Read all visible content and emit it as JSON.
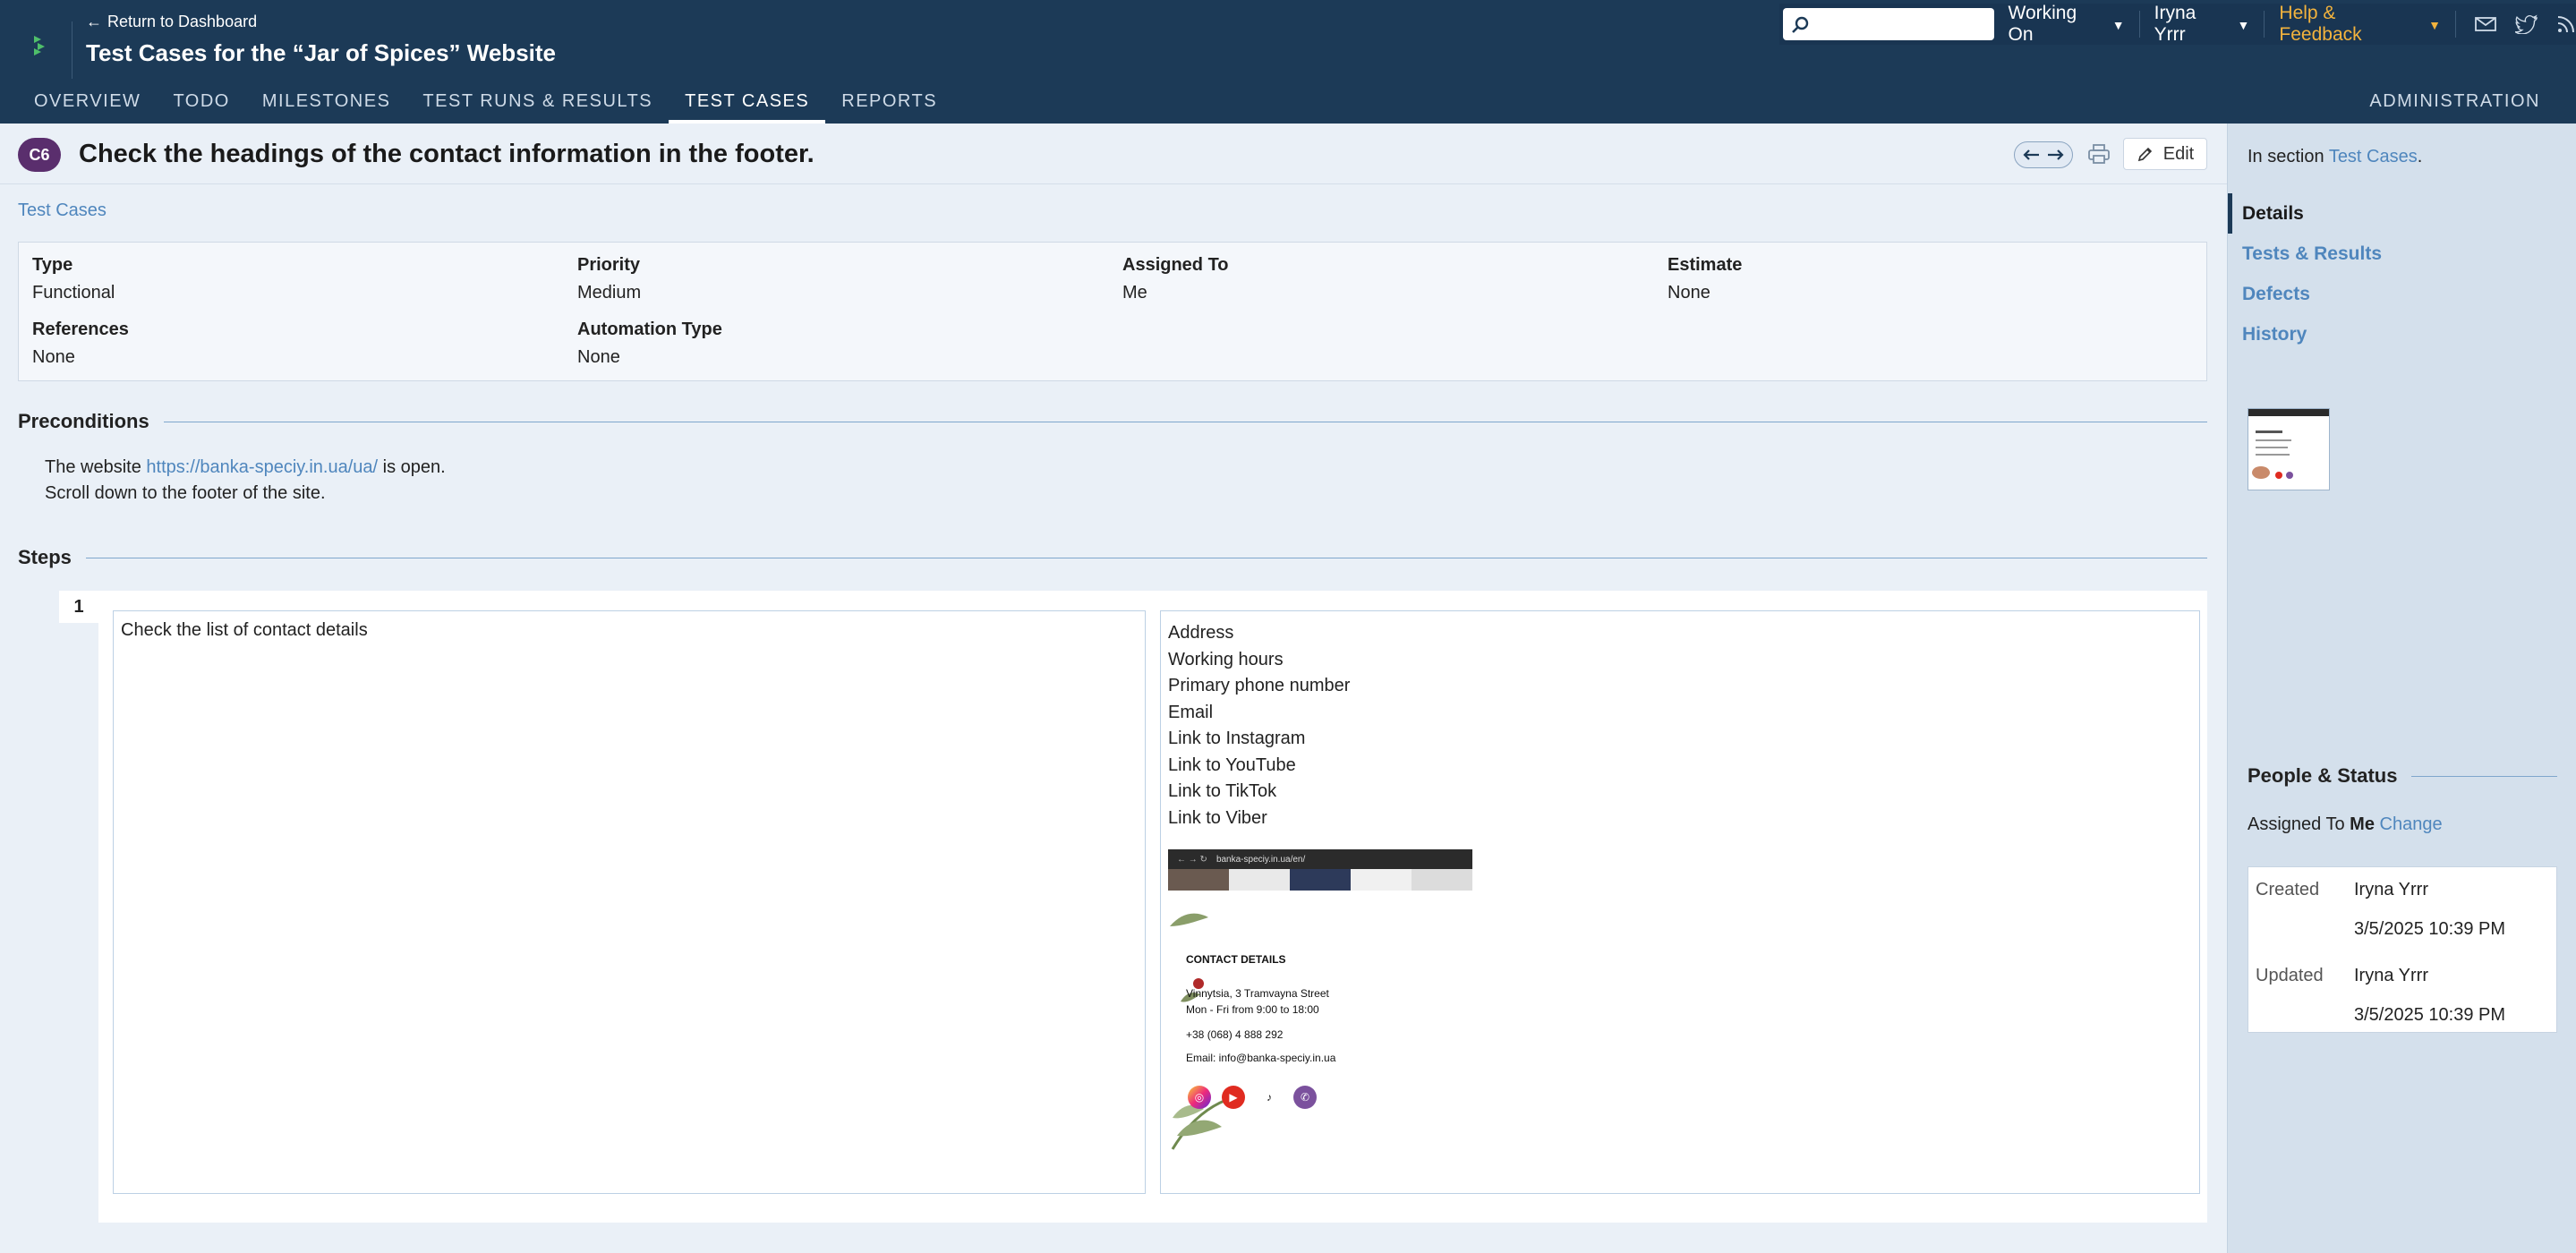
{
  "header": {
    "return_label": "Return to Dashboard",
    "project_title": "Test Cases for the “Jar of Spices” Website",
    "search_placeholder": "",
    "working_on": "Working On",
    "user": "Iryna Yrrr",
    "help": "Help & Feedback",
    "admin": "ADMINISTRATION"
  },
  "nav": {
    "tabs": [
      "OVERVIEW",
      "TODO",
      "MILESTONES",
      "TEST RUNS & RESULTS",
      "TEST CASES",
      "REPORTS"
    ],
    "active": "TEST CASES"
  },
  "case": {
    "id": "C6",
    "title": "Check the headings of the contact information in the footer.",
    "edit_label": "Edit",
    "breadcrumb": "Test Cases"
  },
  "fields": {
    "type_label": "Type",
    "type_value": "Functional",
    "priority_label": "Priority",
    "priority_value": "Medium",
    "assigned_label": "Assigned To",
    "assigned_value": "Me",
    "estimate_label": "Estimate",
    "estimate_value": "None",
    "references_label": "References",
    "references_value": "None",
    "automation_label": "Automation Type",
    "automation_value": "None"
  },
  "preconditions": {
    "heading": "Preconditions",
    "line1_prefix": "The website ",
    "line1_link": "https://banka-speciy.in.ua/ua/",
    "line1_suffix": " is open.",
    "line2": "Scroll down to the footer of the site."
  },
  "steps": {
    "heading": "Steps",
    "items": [
      {
        "number": "1",
        "content": "Check the list of contact details",
        "expected": [
          "Address",
          "Working hours",
          "Primary phone number",
          "Email",
          "Link to Instagram",
          "Link to YouTube",
          "Link to TikTok",
          "Link to Viber"
        ],
        "screenshot": {
          "url": "banka-speciy.in.ua/en/",
          "heading": "CONTACT DETAILS",
          "lines": [
            "Vinnytsia, 3 Tramvayna Street",
            "Mon - Fri from 9:00 to 18:00",
            "+38 (068) 4 888 292",
            "Email: info@banka-speciy.in.ua"
          ]
        }
      }
    ]
  },
  "sidebar": {
    "in_section_prefix": "In section ",
    "in_section_link": "Test Cases",
    "in_section_suffix": ".",
    "nav": [
      "Details",
      "Tests & Results",
      "Defects",
      "History"
    ],
    "people_heading": "People & Status",
    "assigned_prefix": "Assigned To ",
    "assigned_name": "Me",
    "change_label": "Change",
    "created_label": "Created",
    "created_by": "Iryna Yrrr",
    "created_at": "3/5/2025 10:39 PM",
    "updated_label": "Updated",
    "updated_by": "Iryna Yrrr",
    "updated_at": "3/5/2025 10:39 PM"
  },
  "colors": {
    "header_bg": "#1c3a57",
    "link": "#4f86bd",
    "help": "#f3b33d",
    "badge": "#5a2e6d"
  }
}
